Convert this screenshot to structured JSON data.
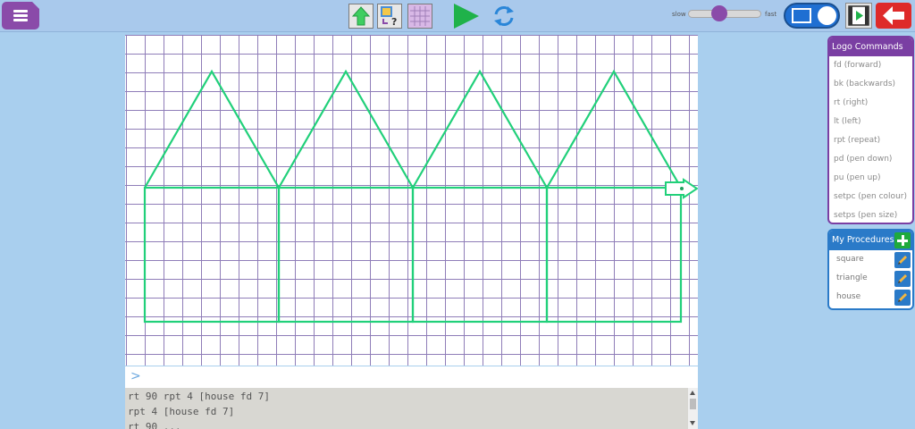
{
  "toolbar": {
    "speed_slow": "slow",
    "speed_fast": "fast"
  },
  "logo_commands": {
    "title": "Logo Commands",
    "items": [
      "fd (forward)",
      "bk (backwards)",
      "rt (right)",
      "lt (left)",
      "rpt (repeat)",
      "pd (pen down)",
      "pu (pen up)",
      "setpc (pen colour)",
      "setps (pen size)"
    ]
  },
  "procedures": {
    "title": "My Procedures",
    "items": [
      "square",
      "triangle",
      "house"
    ]
  },
  "console": {
    "prompt": ">",
    "history": [
      "rt 90 rpt 4 [house fd 7]",
      "rpt 4 [house fd 7]",
      "rt 90 ..."
    ]
  },
  "colors": {
    "pen": "#21d07a",
    "grid": "#8f7db8",
    "accent_purple": "#7a3fa3",
    "accent_blue": "#2a7ac8",
    "back_red": "#de2a2a"
  }
}
